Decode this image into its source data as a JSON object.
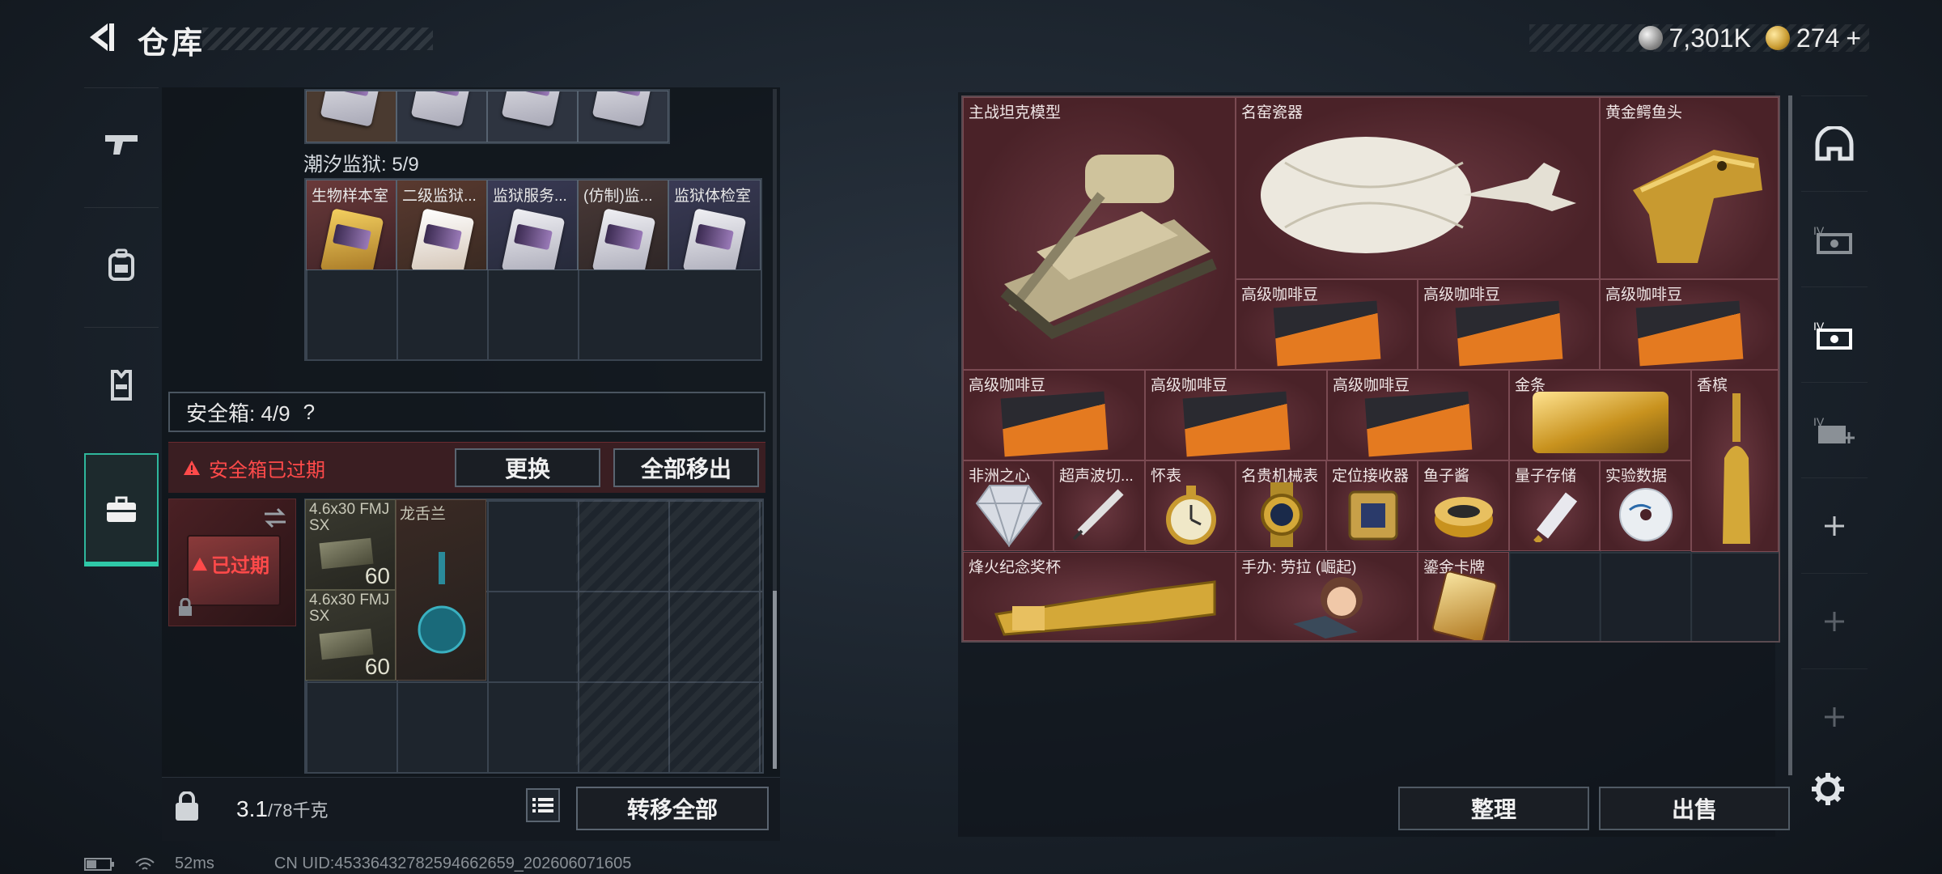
{
  "header": {
    "title": "仓库",
    "currency": [
      {
        "icon": "silver-coin-icon",
        "value": "7,301K"
      },
      {
        "icon": "gold-coin-icon",
        "value": "274",
        "suffix": "+"
      }
    ]
  },
  "left_nav": [
    {
      "icon": "gun-icon"
    },
    {
      "icon": "backpack-icon"
    },
    {
      "icon": "vest-icon"
    },
    {
      "icon": "briefcase-icon"
    }
  ],
  "keycards": {
    "prison_header": "潮汐监狱: 5/9",
    "cards": [
      {
        "label": "生物样本室"
      },
      {
        "label": "二级监狱..."
      },
      {
        "label": "监狱服务..."
      },
      {
        "label": "(仿制)监..."
      },
      {
        "label": "监狱体检室"
      }
    ]
  },
  "safe_box": {
    "header": "安全箱: 4/9",
    "help": "?",
    "warning": "安全箱已过期",
    "replace_button": "更换",
    "move_all_button": "全部移出",
    "expired_label": "已过期",
    "items": [
      {
        "label": "4.6x30 FMJ SX",
        "count": "60"
      },
      {
        "label": "龙舌兰",
        "count": ""
      },
      {
        "label": "4.6x30 FMJ SX",
        "count": "60"
      }
    ]
  },
  "weight": {
    "current": "3.1",
    "max": "/78千克"
  },
  "transfer_all_button": "转移全部",
  "stash": {
    "items": [
      {
        "label": "主战坦克模型"
      },
      {
        "label": "名窑瓷器"
      },
      {
        "label": "黄金鳄鱼头"
      },
      {
        "label": "高级咖啡豆"
      },
      {
        "label": "高级咖啡豆"
      },
      {
        "label": "高级咖啡豆"
      },
      {
        "label": "高级咖啡豆"
      },
      {
        "label": "高级咖啡豆"
      },
      {
        "label": "高级咖啡豆"
      },
      {
        "label": "金条"
      },
      {
        "label": "香槟"
      },
      {
        "label": "非洲之心"
      },
      {
        "label": "超声波切..."
      },
      {
        "label": "怀表"
      },
      {
        "label": "名贵机械表"
      },
      {
        "label": "定位接收器"
      },
      {
        "label": "鱼子酱"
      },
      {
        "label": "量子存储"
      },
      {
        "label": "实验数据"
      },
      {
        "label": "烽火纪念奖杯"
      },
      {
        "label": "手办: 劳拉 (崛起)"
      },
      {
        "label": "鎏金卡牌"
      }
    ]
  },
  "stash_buttons": {
    "sort": "整理",
    "sell": "出售"
  },
  "right_nav": [
    {
      "icon": "helmet-icon"
    },
    {
      "icon": "inventory-iv-icon"
    },
    {
      "icon": "inventory-iv-active-icon"
    },
    {
      "icon": "inventory-iv-add-icon"
    },
    {
      "icon": "plus-icon"
    },
    {
      "icon": "plus-icon"
    },
    {
      "icon": "plus-icon"
    }
  ],
  "status_bar": {
    "ping": "52ms",
    "uid": "CN UID:45336432782594662659_202606071605"
  }
}
